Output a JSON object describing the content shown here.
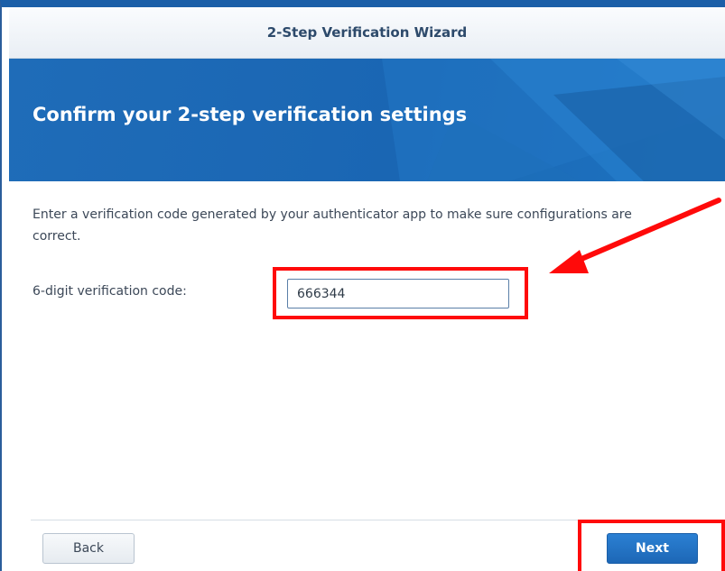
{
  "window": {
    "title": "2-Step Verification Wizard"
  },
  "banner": {
    "title": "Confirm your 2-step verification settings"
  },
  "content": {
    "instructions": "Enter a verification code generated by your authenticator app to make sure configurations are correct.",
    "code_label": "6-digit verification code:",
    "code_value": "666344"
  },
  "footer": {
    "back_label": "Back",
    "next_label": "Next"
  },
  "colors": {
    "accent": "#1b5fa8",
    "banner_blue": "#1a66b3",
    "annotation_red": "#ff0a0a",
    "next_button": "#1d67b6"
  },
  "icons": {
    "annotation": "red-arrow-icon"
  }
}
